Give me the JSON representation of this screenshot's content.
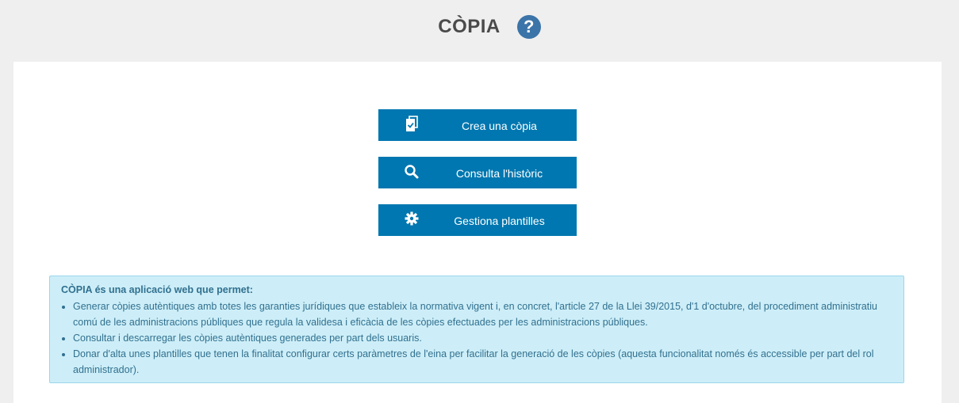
{
  "header": {
    "title": "CÒPIA",
    "help_icon_glyph": "?"
  },
  "actions": [
    {
      "label": "Crea una còpia",
      "icon": "copy-document-check-icon"
    },
    {
      "label": "Consulta l'històric",
      "icon": "search-icon"
    },
    {
      "label": "Gestiona plantilles",
      "icon": "gear-icon"
    }
  ],
  "info": {
    "title": "CÒPIA és una aplicació web que permet:",
    "items": [
      "Generar còpies autèntiques amb totes les garanties jurídiques que estableix la normativa vigent i, en concret, l'article 27 de la Llei 39/2015, d'1 d'octubre, del procediment administratiu comú de les administracions públiques que regula la validesa i eficàcia de les còpies efectuades per les administracions públiques.",
      "Consultar i descarregar les còpies autèntiques generades per part dels usuaris.",
      "Donar d'alta unes plantilles que tenen la finalitat configurar certs paràmetres de l'eina per facilitar la generació de les còpies (aquesta funcionalitat només és accessible per part del rol administrador)."
    ]
  },
  "colors": {
    "background": "#efefef",
    "panel": "#ffffff",
    "button": "#0077b0",
    "help_icon": "#3b74a8",
    "info_background": "#cdeef8",
    "info_border": "#9ad6ea",
    "info_text": "#31708f"
  }
}
